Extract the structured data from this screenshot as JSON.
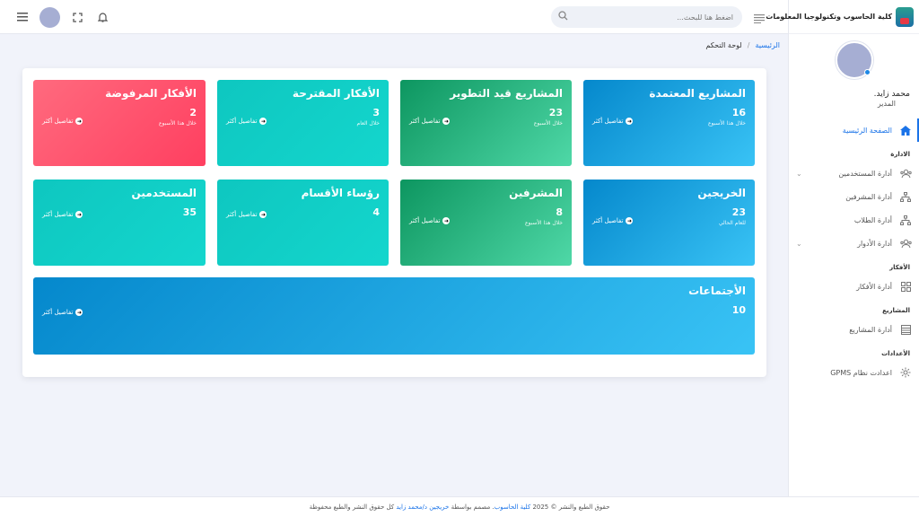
{
  "brand": {
    "title": "كلية الحاسوب وتكنولوجيا المعلومات"
  },
  "header": {
    "search_placeholder": "اضغط هنا للبحث..."
  },
  "profile": {
    "name": "محمد زايد.",
    "role": "المدير"
  },
  "nav": {
    "home": "الصفحة الرئيسية",
    "section_admin": "الادارة",
    "users": "أدارة المستخدمين",
    "supervisors": "أدارة المشرفين",
    "students": "أدارة الطلاب",
    "roles": "أدارة الأدوار",
    "section_ideas": "الأفكار",
    "ideas": "أدارة الأفكار",
    "section_projects": "المشاريع",
    "projects": "أدارة المشاريع",
    "section_settings": "الأعدادات",
    "settings": "اعدادت نظام GPMS"
  },
  "breadcrumb": {
    "home": "الرئيسية",
    "sep": "/",
    "current": "لوحة التحكم"
  },
  "cards": [
    {
      "title": "المشاريع المعتمدة",
      "count": "16",
      "sub": "خلال هذا الأسبوع",
      "link": "تفاصيل أكثر",
      "color": "#0588cc"
    },
    {
      "title": "المشاريع قيد التطوير",
      "count": "23",
      "sub": "خلال الأسبوع",
      "link": "تفاصيل أكثر",
      "color": "#0d9660"
    },
    {
      "title": "الأفكار المقترحة",
      "count": "3",
      "sub": "خلال العام",
      "link": "تفاصيل أكثر",
      "color": "#0ec7c0"
    },
    {
      "title": "الأفكار المرفوضة",
      "count": "2",
      "sub": "خلال هذا الأسبوع",
      "link": "تفاصيل أكثر",
      "color": "#ff3f60"
    },
    {
      "title": "الخريجين",
      "count": "23",
      "sub": "للعام الحالي",
      "link": "تفاصيل أكثر",
      "color": "#0588cc"
    },
    {
      "title": "المشرفين",
      "count": "8",
      "sub": "خلال هذا الأسبوع",
      "link": "تفاصيل أكثر",
      "color": "#0d9660"
    },
    {
      "title": "رؤساء الأقسام",
      "count": "4",
      "sub": "",
      "link": "تفاصيل أكثر",
      "color": "#0ec7c0"
    },
    {
      "title": "المستخدمين",
      "count": "35",
      "sub": "",
      "link": "تفاصيل أكثر",
      "color": "#0ec7c0"
    },
    {
      "title": "الأجتماعات",
      "count": "10",
      "sub": "",
      "link": "تفاصيل أكثر",
      "color": "#0588cc"
    }
  ],
  "footer": {
    "text1": "حقوق الطبع والنشر © 2025",
    "college": "كلية الحاسوب",
    "text2": ". مصمم بواسطة",
    "designer": "خريجين د/محمد زايد",
    "text3": "كل حقوق النشر والطبع محفوظة"
  }
}
